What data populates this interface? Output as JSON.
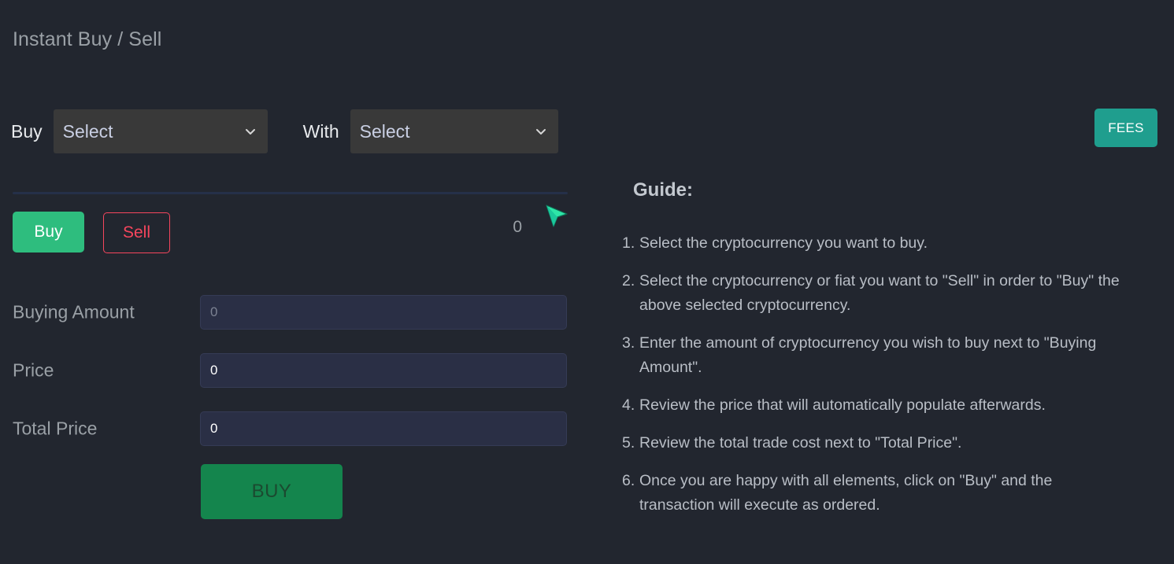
{
  "page": {
    "title": "Instant Buy / Sell",
    "background_color": "#22262f"
  },
  "selector_row": {
    "buy_label": "Buy",
    "buy_select": {
      "selected": "Select",
      "options": [
        "Select"
      ],
      "icon": "chevron-down-icon"
    },
    "with_label": "With",
    "with_select": {
      "selected": "Select",
      "options": [
        "Select"
      ],
      "icon": "chevron-down-icon"
    }
  },
  "fees_button": {
    "label": "FEES",
    "color": "#1f9e8e"
  },
  "toggle": {
    "buy_label": "Buy",
    "sell_label": "Sell",
    "buy_color": "#2ebd7e",
    "sell_color": "#f6465d",
    "active": "Buy",
    "balance_value": "0"
  },
  "form": {
    "fields": [
      {
        "label": "Buying Amount",
        "value": "",
        "placeholder": "0"
      },
      {
        "label": "Price",
        "value": "0",
        "placeholder": "0"
      },
      {
        "label": "Total Price",
        "value": "0",
        "placeholder": "0"
      }
    ],
    "submit_label": "BUY",
    "submit_color": "#14854d"
  },
  "guide": {
    "title": "Guide:",
    "items": [
      {
        "num": "1.",
        "text": "Select the cryptocurrency you want to buy."
      },
      {
        "num": "2.",
        "text": "Select the cryptocurrency or fiat you want to \"Sell\" in order to \"Buy\" the above selected cryptocurrency."
      },
      {
        "num": "3.",
        "text": "Enter the amount of cryptocurrency you wish to buy next to \"Buying Amount\"."
      },
      {
        "num": "4.",
        "text": "Review the price that will automatically populate afterwards."
      },
      {
        "num": "5.",
        "text": "Review the total trade cost next to \"Total Price\"."
      },
      {
        "num": "6.",
        "text": "Once you are happy with all elements, click on \"Buy\" and the transaction will execute as ordered."
      }
    ]
  },
  "cursor": {
    "icon": "mouse-pointer-icon",
    "color": "#2ee6a8"
  }
}
